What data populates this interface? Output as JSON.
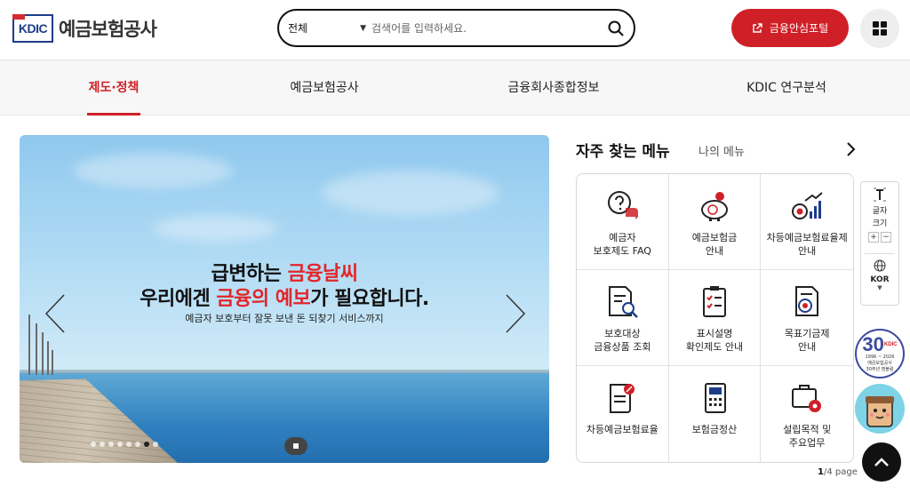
{
  "header": {
    "logo_mark": "KDIC",
    "logo_text": "예금보험공사",
    "search": {
      "category": "전체",
      "placeholder": "검색어를 입력하세요."
    },
    "portal_button": "금융안심포털"
  },
  "nav": {
    "items": [
      {
        "label": "제도·정책",
        "active": true
      },
      {
        "label": "예금보험공사",
        "active": false
      },
      {
        "label": "금융회사종합정보",
        "active": false
      },
      {
        "label": "KDIC 연구분석",
        "active": false
      }
    ]
  },
  "banner": {
    "line1_prefix": "급변하는 ",
    "line1_red": "금융날씨",
    "line2_prefix": "우리에겐 ",
    "line2_red1": "금융의",
    "line2_mid": " ",
    "line2_red2": "예보",
    "line2_suffix": "가 필요합니다.",
    "subtitle": "예금자 보호부터 잘못 보낸 돈 되찾기 서비스까지",
    "slide_count": 8,
    "active_slide": 7
  },
  "favorites": {
    "title": "자주 찾는 메뉴",
    "my_menu": "나의 메뉴",
    "items": [
      {
        "label": "예금자\n보호제도 FAQ",
        "icon": "faq-chat-icon"
      },
      {
        "label": "예금보험금\n안내",
        "icon": "piggy-bank-icon"
      },
      {
        "label": "차등예금보험료율제\n안내",
        "icon": "growth-chart-icon"
      },
      {
        "label": "보호대상\n금융상품 조회",
        "icon": "document-search-icon"
      },
      {
        "label": "표시설명\n확인제도 안내",
        "icon": "checklist-icon"
      },
      {
        "label": "목표기금제\n안내",
        "icon": "fund-document-icon"
      },
      {
        "label": "차등예금보험료율",
        "icon": "rate-document-icon"
      },
      {
        "label": "보험금정산",
        "icon": "calculator-icon"
      },
      {
        "label": "설립목적 및\n주요업무",
        "icon": "briefcase-gear-icon"
      }
    ],
    "page_current": "1",
    "page_total": "/4 page"
  },
  "side_tools": {
    "text_size_line1": "글자",
    "text_size_line2": "크기",
    "plus": "+",
    "minus": "−",
    "language": "KOR",
    "anniversary_number": "30",
    "anniversary_tag": "KDIC",
    "anniversary_years": "1996 ~ 2026",
    "anniversary_caption": "예금보험공사\n30주년 엠블럼"
  }
}
